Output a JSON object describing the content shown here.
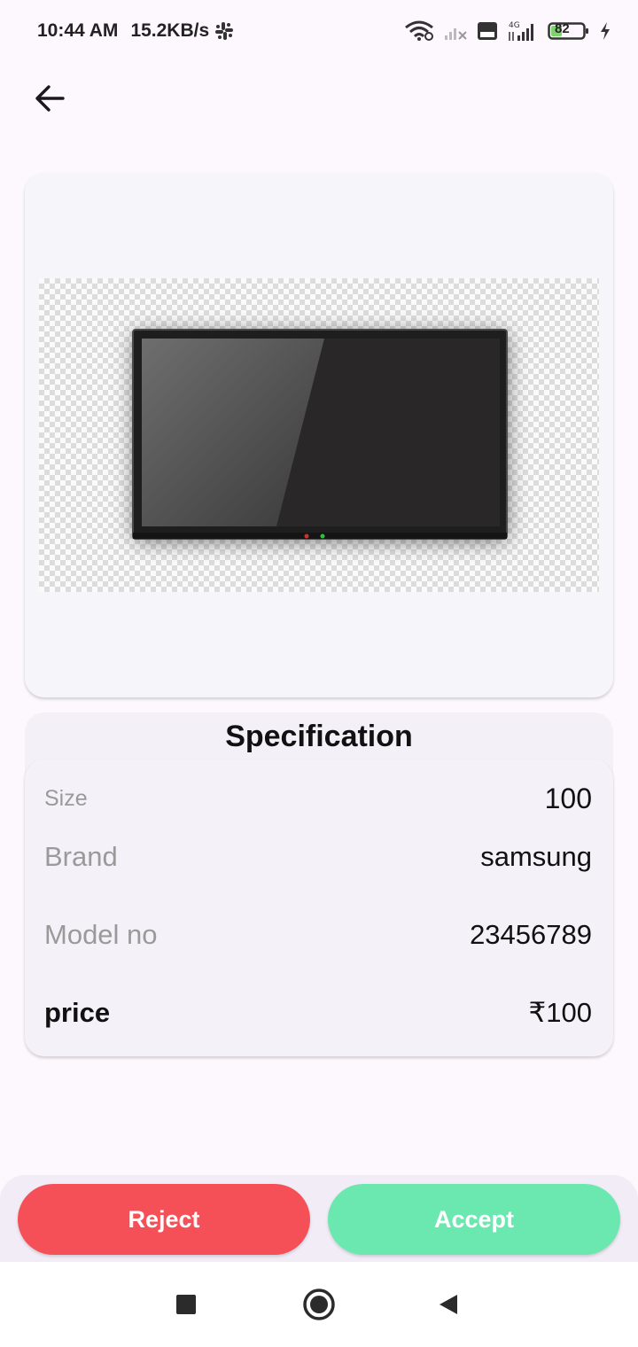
{
  "status_bar": {
    "time": "10:44 AM",
    "network_speed": "15.2KB/s",
    "battery_level": "82",
    "icons": [
      "slack-icon",
      "wifi-icon",
      "signal-x-icon",
      "volte-icon",
      "4g-signal-icon",
      "battery-icon",
      "charging-icon"
    ]
  },
  "header": {
    "back_icon": "arrow-left-icon"
  },
  "product": {
    "image_alt": "television-icon"
  },
  "specification": {
    "title": "Specification",
    "rows": [
      {
        "label": "Size",
        "value": "100"
      },
      {
        "label": "Brand",
        "value": "samsung"
      },
      {
        "label": "Model no",
        "value": "23456789"
      },
      {
        "label": "price",
        "value": "₹100"
      }
    ]
  },
  "actions": {
    "reject_label": "Reject",
    "accept_label": "Accept",
    "reject_color": "#f55057",
    "accept_color": "#6be8b0"
  },
  "nav": {
    "icons": [
      "recents-square-icon",
      "home-circle-icon",
      "back-triangle-icon"
    ]
  }
}
